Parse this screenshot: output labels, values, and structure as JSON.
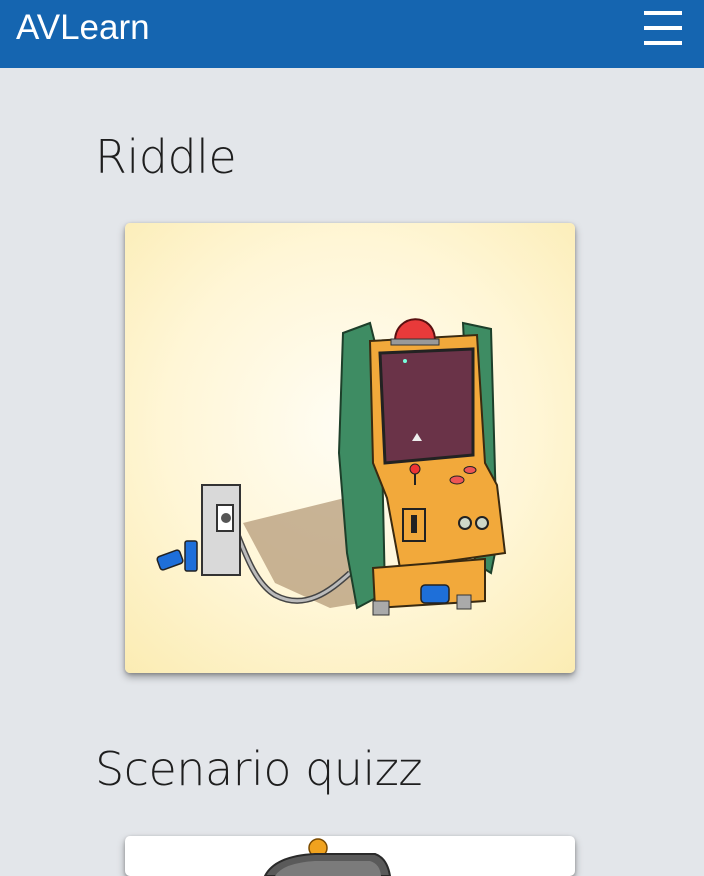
{
  "app": {
    "title": "AVLearn"
  },
  "header": {
    "menu_icon": "hamburger-menu-icon"
  },
  "sections": [
    {
      "title": "Riddle",
      "image": "arcade-machine-illustration"
    },
    {
      "title": "Scenario quizz",
      "image": "robot-illustration"
    }
  ],
  "colors": {
    "header": "#1565b0",
    "background": "#e3e6ea",
    "card1_bg": "#fff6d6"
  }
}
